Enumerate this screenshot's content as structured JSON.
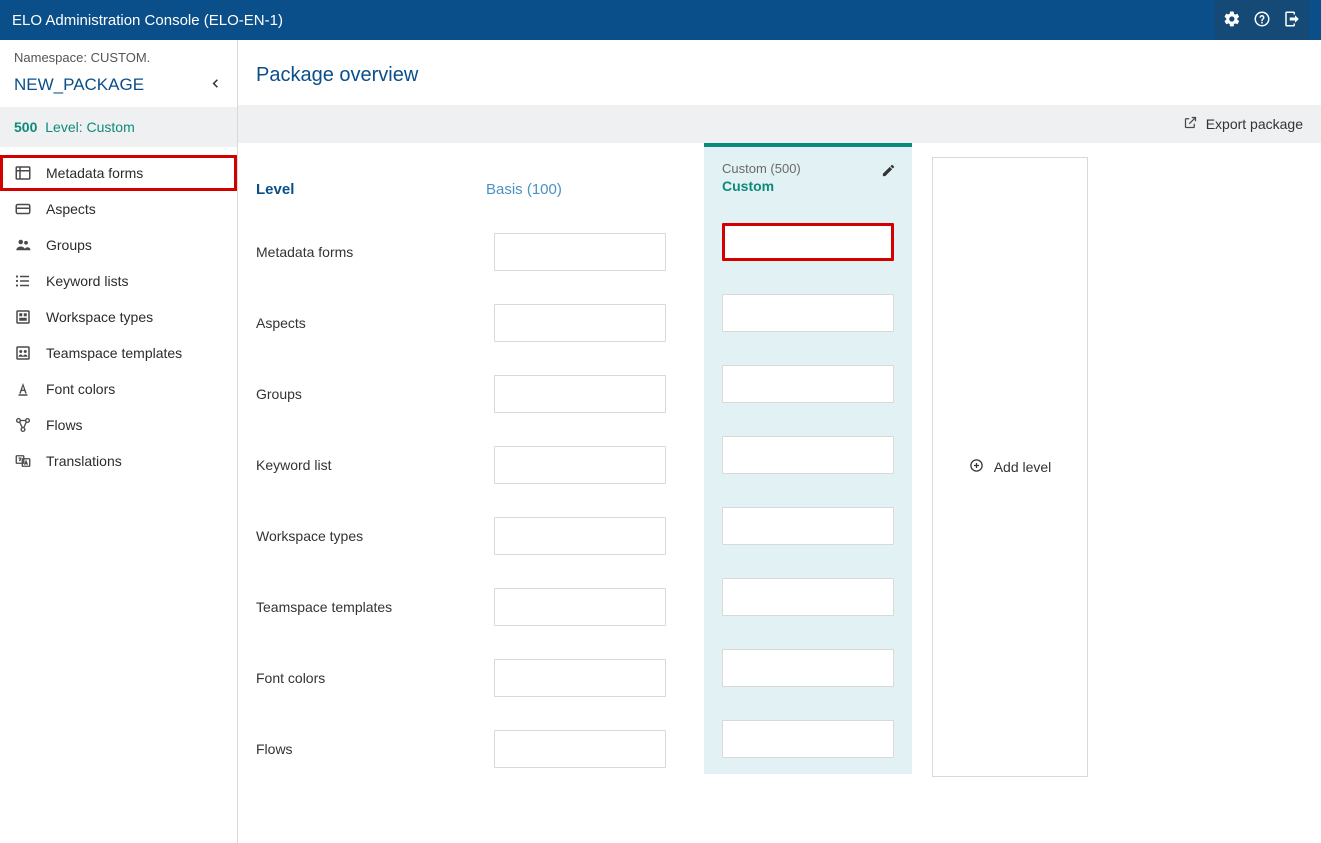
{
  "topbar": {
    "title": "ELO Administration Console (ELO-EN-1)"
  },
  "sidebar": {
    "namespace_label": "Namespace: CUSTOM.",
    "package_name": "NEW_PACKAGE",
    "level_code": "500",
    "level_label": "Level: Custom",
    "items": [
      {
        "label": "Metadata forms"
      },
      {
        "label": "Aspects"
      },
      {
        "label": "Groups"
      },
      {
        "label": "Keyword lists"
      },
      {
        "label": "Workspace types"
      },
      {
        "label": "Teamspace templates"
      },
      {
        "label": "Font colors"
      },
      {
        "label": "Flows"
      },
      {
        "label": "Translations"
      }
    ]
  },
  "main": {
    "title": "Package overview",
    "export_label": "Export package",
    "row_header_label": "Level",
    "basis_col_label": "Basis (100)",
    "custom_col_sub": "Custom (500)",
    "custom_col_name": "Custom",
    "add_level_label": "Add level",
    "rows": [
      "Metadata forms",
      "Aspects",
      "Groups",
      "Keyword list",
      "Workspace types",
      "Teamspace templates",
      "Font colors",
      "Flows"
    ]
  }
}
